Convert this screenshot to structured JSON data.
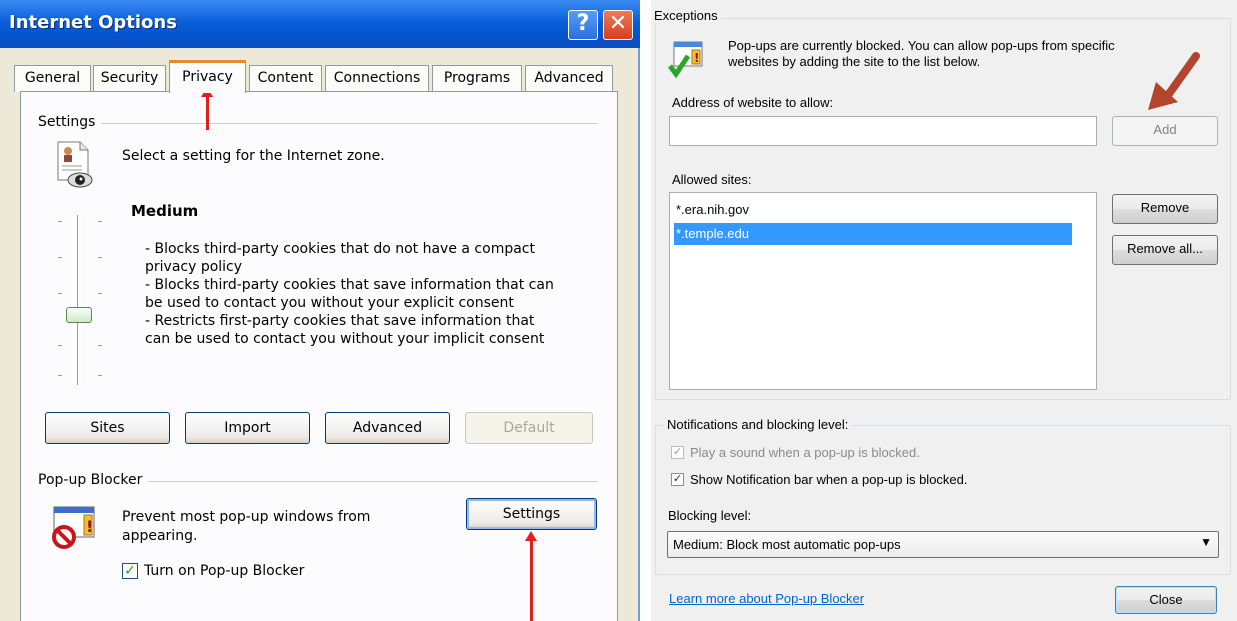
{
  "internet_options": {
    "title": "Internet Options",
    "help_glyph": "?",
    "close_glyph": "✕",
    "tabs": [
      {
        "label": "General"
      },
      {
        "label": "Security"
      },
      {
        "label": "Privacy"
      },
      {
        "label": "Content"
      },
      {
        "label": "Connections"
      },
      {
        "label": "Programs"
      },
      {
        "label": "Advanced"
      }
    ],
    "active_tab": "Privacy",
    "settings_group": "Settings",
    "zone_text": "Select a setting for the Internet zone.",
    "level_name": "Medium",
    "level_desc": [
      "- Blocks third-party cookies that do not have a compact",
      "privacy policy",
      "- Blocks third-party cookies that save information that can",
      "be used to contact you without your explicit consent",
      "- Restricts first-party cookies that save information that",
      "can be used to contact you without your implicit consent"
    ],
    "buttons": {
      "sites": "Sites",
      "import": "Import",
      "advanced": "Advanced",
      "default": "Default"
    },
    "popup_group": "Pop-up Blocker",
    "popup_text_1": "Prevent most pop-up windows from",
    "popup_text_2": "appearing.",
    "popup_settings": "Settings",
    "turn_on_label": "Turn on Pop-up Blocker",
    "turn_on_checked": true
  },
  "popup_settings": {
    "exceptions_group": "Exceptions",
    "info_line1": "Pop-ups are currently blocked.  You can allow pop-ups from specific",
    "info_line2": "websites by adding the site to the list below.",
    "address_label": "Address of website to allow:",
    "address_value": "",
    "add_button": "Add",
    "allowed_label": "Allowed sites:",
    "allowed_sites": [
      "*.era.nih.gov",
      "*.temple.edu"
    ],
    "selected_site": "*.temple.edu",
    "remove_button": "Remove",
    "remove_all_button": "Remove all...",
    "notifications_group": "Notifications and blocking level:",
    "play_sound_label": "Play a sound when a pop-up is blocked.",
    "show_bar_label": "Show Notification bar when a pop-up is blocked.",
    "blocking_level_label": "Blocking level:",
    "blocking_level_value": "Medium: Block most automatic pop-ups",
    "learn_more": "Learn more about Pop-up Blocker",
    "close_button": "Close"
  },
  "colors": {
    "xp_title": "#0554d0",
    "tab_accent": "#e68b2c",
    "annotation_arrow": "#e0201c",
    "selection": "#3399ff",
    "link": "#0066cc"
  }
}
